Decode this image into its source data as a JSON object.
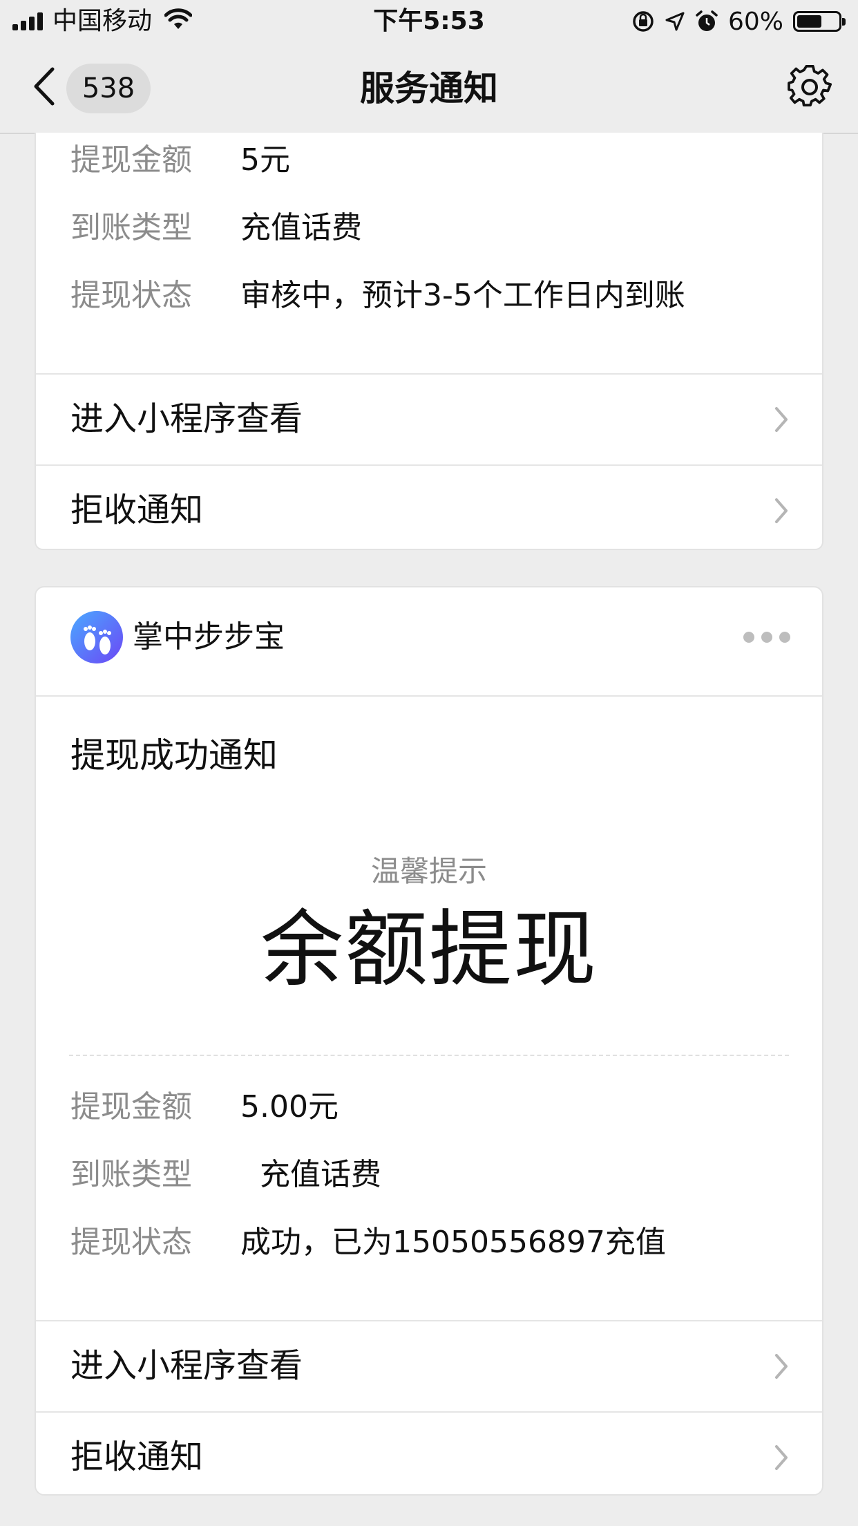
{
  "status_bar": {
    "carrier": "中国移动",
    "time": "下午5:53",
    "battery_text": "60%",
    "battery_level": 0.6
  },
  "nav": {
    "back_icon": "chevron-left-icon",
    "badge_count": "538",
    "title": "服务通知",
    "settings_icon": "gear-icon"
  },
  "card_top": {
    "rows": [
      {
        "key": "提现金额",
        "value": "5元"
      },
      {
        "key": "到账类型",
        "value": "充值话费"
      },
      {
        "key": "提现状态",
        "value": "审核中，预计3-5个工作日内到账"
      }
    ],
    "links": [
      {
        "label": "进入小程序查看"
      },
      {
        "label": "拒收通知"
      }
    ]
  },
  "card_bottom": {
    "source_name": "掌中步步宝",
    "notice_title": "提现成功通知",
    "hint": "温馨提示",
    "headline": "余额提现",
    "rows": [
      {
        "key": "提现金额",
        "value": "5.00元"
      },
      {
        "key": "到账类型",
        "value": "  充值话费"
      },
      {
        "key": "提现状态",
        "value": "成功，已为15050556897充值"
      }
    ],
    "links": [
      {
        "label": "进入小程序查看"
      },
      {
        "label": "拒收通知"
      }
    ]
  },
  "colors": {
    "background": "#ededed",
    "card": "#ffffff",
    "label_gray": "#8c8c8c",
    "logo_gradient_start": "#4aa9ff",
    "logo_gradient_end": "#6c47f5"
  }
}
